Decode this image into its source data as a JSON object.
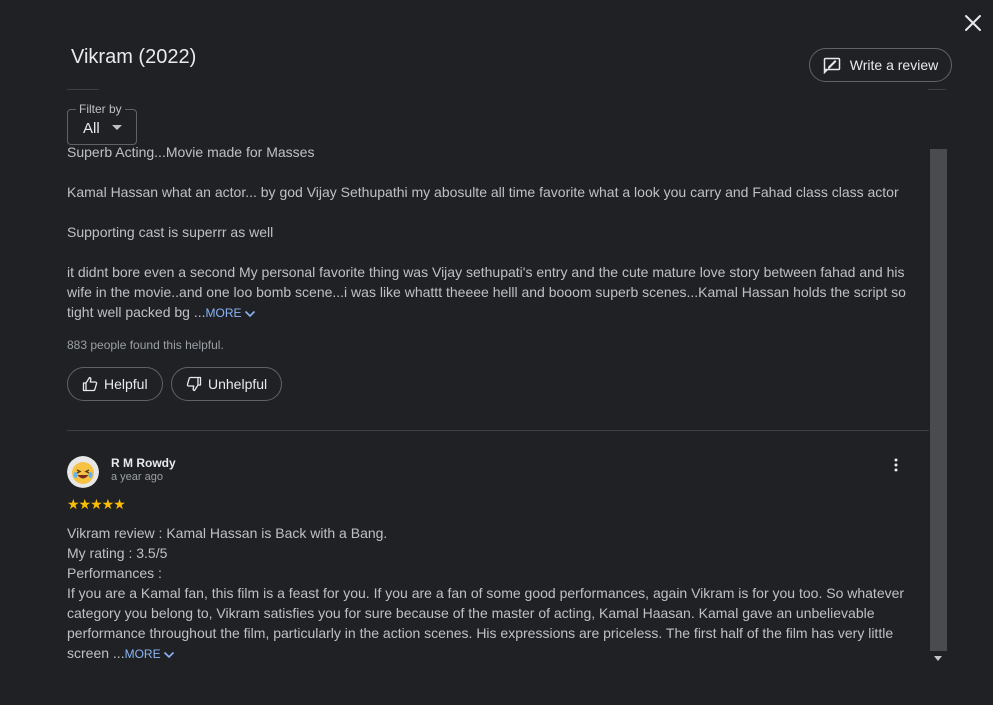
{
  "header": {
    "title": "Vikram (2022)",
    "write_review_label": "Write a review"
  },
  "filter": {
    "label": "Filter by",
    "value": "All"
  },
  "review1": {
    "lines": [
      "Superb Acting...Movie made for Masses",
      "Kamal Hassan what an actor... by god Vijay Sethupathi my abosulte all time favorite what a look you carry and Fahad class class actor",
      "Supporting cast is superrr as well",
      "it didnt bore even a second My personal favorite thing was Vijay sethupati's entry and the cute mature love story between fahad and his wife in the movie..and one loo bomb scene...i was like whattt theeee helll and booom superb scenes...Kamal Hassan holds the script so tight well packed bg ..."
    ],
    "more_label": "MORE",
    "helpful_text": "883 people found this helpful.",
    "helpful_label": "Helpful",
    "unhelpful_label": "Unhelpful"
  },
  "review2": {
    "author": "R M Rowdy",
    "date": "a year ago",
    "stars": "★★★★★",
    "lines": [
      "Vikram review : Kamal Hassan is Back with a Bang.",
      "My rating : 3.5/5",
      "Performances :",
      "If you are a Kamal fan, this film is a feast for you. If you are a fan of some good performances, again Vikram is for you too. So whatever category you belong to, Vikram satisfies you for sure because of the master of acting, Kamal Haasan. Kamal gave an unbelievable performance throughout the film, particularly in the action scenes. His expressions are priceless. The first half of the film has very little screen ..."
    ],
    "more_label": "MORE"
  },
  "colors": {
    "background": "#202124",
    "link": "#8ab4f8",
    "star": "#fbbc04"
  }
}
